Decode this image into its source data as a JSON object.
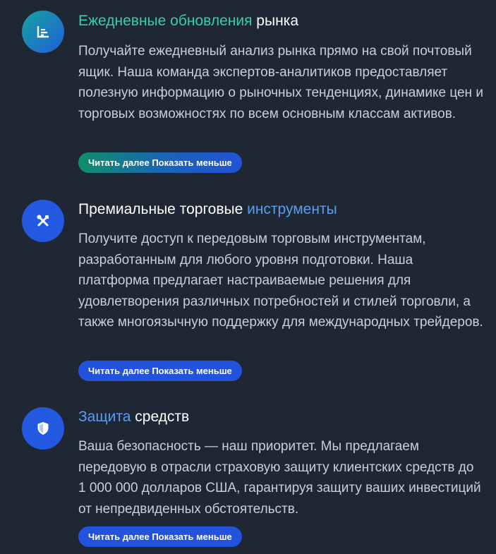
{
  "features": [
    {
      "icon": "chart-icon",
      "title_accent": "Ежедневные обновления",
      "title_rest": "рынка",
      "description": "Получайте ежедневный анализ рынка прямо на свой почтовый ящик. Наша команда экспертов-аналитиков предоставляет полезную информацию о рыночных тенденциях, динамике цен и торговых возможностях по всем основным классам активов.",
      "button_label": "Читать далее Показать меньше"
    },
    {
      "icon": "tools-icon",
      "title_rest_first": "Премиальные торговые",
      "title_accent": "инструменты",
      "description": "Получите доступ к передовым торговым инструментам, разработанным для любого уровня подготовки. Наша платформа предлагает настраиваемые решения для удовлетворения различных потребностей и стилей торговли, а также многоязычную поддержку для международных трейдеров.",
      "button_label": "Читать далее Показать меньше"
    },
    {
      "icon": "shield-icon",
      "title_accent": "Защита",
      "title_rest": "средств",
      "description": "Ваша безопасность — наш приоритет. Мы предлагаем передовую в отрасли страховую защиту клиентских средств до 1 000 000 долларов США, гарантируя защиту ваших инвестиций от непредвиденных обстоятельств.",
      "button_label": "Читать далее Показать меньше"
    }
  ],
  "colors": {
    "background": "#1f2734",
    "accent_green": "#33d1a3",
    "accent_blue": "#5b9cf3",
    "button_blue": "#2353dd"
  }
}
